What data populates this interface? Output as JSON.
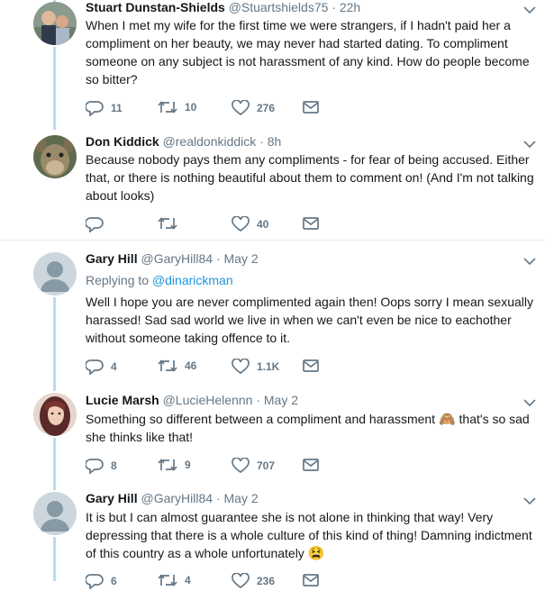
{
  "tweets": [
    {
      "name": "Stuart Dunstan-Shields",
      "handle": "@Stuartshields75",
      "time": "22h",
      "text": "When I met my wife for the first time we were strangers, if I hadn't paid her a compliment on her beauty, we may never had started dating. To compliment someone on any subject is not harassment of any kind. How do people become so bitter?",
      "replies": "11",
      "retweets": "10",
      "likes": "276"
    },
    {
      "name": "Don Kiddick",
      "handle": "@realdonkiddick",
      "time": "8h",
      "text": "Because nobody pays them any compliments - for fear of being accused.  Either that, or there is nothing beautiful about them to comment on! (And I'm not talking about looks)",
      "replies": "",
      "retweets": "",
      "likes": "40"
    },
    {
      "name": "Gary Hill",
      "handle": "@GaryHill84",
      "time": "May 2",
      "replying_label": "Replying to",
      "replying_to": "@dinarickman",
      "text": "Well I hope you are never complimented again then! Oops sorry I mean sexually harassed! Sad sad world we live in when we can't even be nice to eachother without someone taking offence to it.",
      "replies": "4",
      "retweets": "46",
      "likes": "1.1K"
    },
    {
      "name": "Lucie Marsh",
      "handle": "@LucieHelennn",
      "time": "May 2",
      "text_before": "Something so different between a compliment and harassment",
      "emoji": "🙈",
      "text_after": "that's so sad she thinks like that!",
      "replies": "8",
      "retweets": "9",
      "likes": "707"
    },
    {
      "name": "Gary Hill",
      "handle": "@GaryHill84",
      "time": "May 2",
      "text_before": "It is but I can almost guarantee she is not alone in thinking that way! Very depressing that there is a whole culture of this kind of thing! Damning indictment of this country as a whole unfortunately",
      "emoji": "😫",
      "replies": "6",
      "retweets": "4",
      "likes": "236"
    }
  ],
  "separator": "·"
}
